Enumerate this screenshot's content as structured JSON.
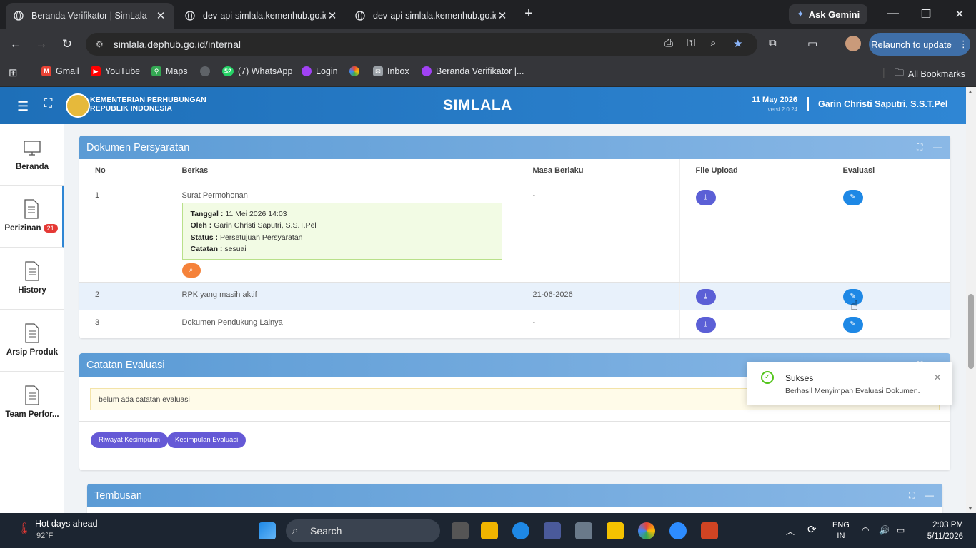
{
  "browser": {
    "tabs": [
      {
        "title": "Beranda Verifikator | SimLala",
        "active": true
      },
      {
        "title": "dev-api-simlala.kemenhub.go.id",
        "active": false
      },
      {
        "title": "dev-api-simlala.kemenhub.go.id",
        "active": false
      }
    ],
    "ask_gemini": "Ask Gemini",
    "url": "simlala.dephub.go.id/internal",
    "relaunch": "Relaunch to update",
    "bookmarks": [
      "Gmail",
      "YouTube",
      "Maps",
      "",
      "(7) WhatsApp",
      "Login",
      "",
      "Inbox",
      "Beranda Verifikator |..."
    ],
    "whatsapp_count": "52",
    "all_bookmarks": "All Bookmarks"
  },
  "header": {
    "ministry_line1": "KEMENTERIAN PERHUBUNGAN",
    "ministry_line2": "REPUBLIK INDONESIA",
    "app_name": "SIMLALA",
    "date": "11 May 2026",
    "version": "versi 2.0.24",
    "user": "Garin Christi Saputri, S.S.T.Pel"
  },
  "sidebar": {
    "items": [
      {
        "label": "Beranda",
        "badge": "",
        "icon": "monitor-icon"
      },
      {
        "label": "Perizinan",
        "badge": "21",
        "icon": "document-icon"
      },
      {
        "label": "History",
        "badge": "",
        "icon": "document-icon"
      },
      {
        "label": "Arsip Produk",
        "badge": "",
        "icon": "document-icon"
      },
      {
        "label": "Team Perfor...",
        "badge": "",
        "icon": "document-icon"
      }
    ]
  },
  "dokumen": {
    "title": "Dokumen Persyaratan",
    "columns": [
      "No",
      "Berkas",
      "Masa Berlaku",
      "File Upload",
      "Evaluasi"
    ],
    "rows": [
      {
        "no": "1",
        "berkas": "Surat Permohonan",
        "masa": "-"
      },
      {
        "no": "2",
        "berkas": "RPK yang masih aktif",
        "masa": "21-06-2026"
      },
      {
        "no": "3",
        "berkas": "Dokumen Pendukung Lainya",
        "masa": "-"
      }
    ],
    "info": {
      "tanggal_label": "Tanggal :",
      "tanggal": "11 Mei 2026 14:03",
      "oleh_label": "Oleh :",
      "oleh": "Garin Christi Saputri, S.S.T.Pel",
      "status_label": "Status :",
      "status": "Persetujuan Persyaratan",
      "catatan_label": "Catatan :",
      "catatan": "sesuai"
    }
  },
  "catatan": {
    "title": "Catatan Evaluasi",
    "note": "belum ada catatan evaluasi",
    "btn_riwayat": "Riwayat Kesimpulan",
    "btn_kesimpulan": "Kesimpulan Evaluasi"
  },
  "tembusan": {
    "title": "Tembusan"
  },
  "toast": {
    "title": "Sukses",
    "message": "Berhasil Menyimpan Evaluasi Dokumen."
  },
  "taskbar": {
    "weather_title": "Hot days ahead",
    "weather_temp": "92°F",
    "search": "Search",
    "lang1": "ENG",
    "lang2": "IN",
    "time": "2:03 PM",
    "date": "5/11/2026"
  },
  "colors": {
    "header": "#2f86d4",
    "card_header": "#5b9bd5",
    "button_purple": "#6559d6",
    "success": "#52c41a"
  }
}
